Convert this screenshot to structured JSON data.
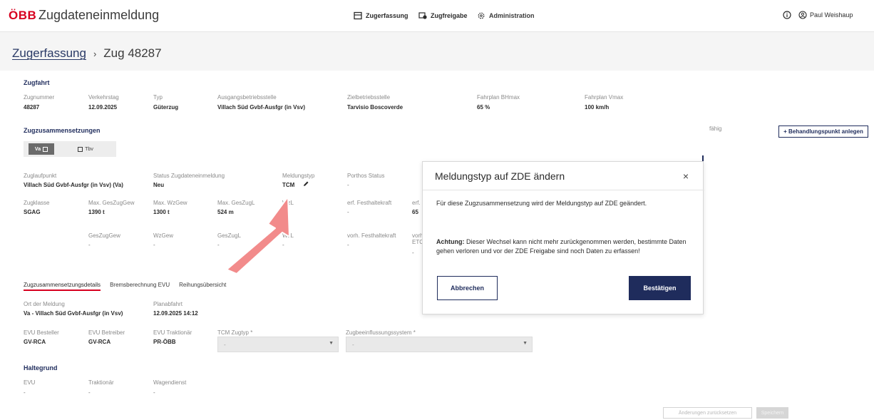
{
  "header": {
    "logo": "ÖBB",
    "app_title": "Zugdateneinmeldung",
    "nav": [
      {
        "label": "Zugerfassung",
        "icon": "train-window-icon"
      },
      {
        "label": "Zugfreigabe",
        "icon": "route-check-icon"
      },
      {
        "label": "Administration",
        "icon": "gear-icon"
      }
    ],
    "user": "Paul Weishaup"
  },
  "breadcrumb": {
    "link": "Zugerfassung",
    "separator": "›",
    "current": "Zug 48287"
  },
  "zugfahrt": {
    "heading": "Zugfahrt",
    "fields": [
      {
        "label": "Zugnummer",
        "value": "48287"
      },
      {
        "label": "Verkehrstag",
        "value": "12.09.2025"
      },
      {
        "label": "Typ",
        "value": "Güterzug"
      },
      {
        "label": "Ausgangsbetriebsstelle",
        "value": "Villach Süd Gvbf-Ausfgr (in Vsv)"
      },
      {
        "label": "Zielbetriebsstelle",
        "value": "Tarvisio Boscoverde"
      },
      {
        "label": "Fahrplan BHmax",
        "value": "65 %"
      },
      {
        "label": "Fahrplan Vmax",
        "value": "100 km/h"
      }
    ]
  },
  "zugzusammensetzungen": {
    "heading": "Zugzusammensetzungen",
    "add_button": "+ Behandlungspunkt anlegen",
    "pills": [
      {
        "label": "Va"
      },
      {
        "label": "Tbv"
      }
    ],
    "row1": [
      {
        "label": "Zuglaufpunkt",
        "value": "Villach Süd Gvbf-Ausfgr (in Vsv) (Va)"
      },
      {
        "label": "Status Zugdateneinmeldung",
        "value": "Neu"
      },
      {
        "label": "Meldungstyp",
        "value": "TCM"
      },
      {
        "label": "Porthos Status",
        "value": "-"
      }
    ],
    "row2": [
      {
        "label": "Zugklasse",
        "value": "SGAG"
      },
      {
        "label": "Max. GesZugGew",
        "value": "1390 t"
      },
      {
        "label": "Max. WzGew",
        "value": "1300 t"
      },
      {
        "label": "Max. GesZugL",
        "value": "524 m"
      },
      {
        "label": "WzL",
        "value": "m"
      },
      {
        "label": "erf. Festhaltekraft",
        "value": "-"
      },
      {
        "label": "erf.",
        "value": "65"
      }
    ],
    "row3": [
      {
        "label": "GesZugGew",
        "value": "-"
      },
      {
        "label": "WzGew",
        "value": "-"
      },
      {
        "label": "GesZugL",
        "value": "-"
      },
      {
        "label": "WzL",
        "value": "-"
      },
      {
        "label": "vorh. Festhaltekraft",
        "value": "-"
      },
      {
        "label": "vorh",
        "value": "ETC"
      },
      {
        "label": "",
        "value": "-"
      }
    ],
    "cutoff_label": "fähig"
  },
  "tabs": [
    "Zugzusammensetzungsdetails",
    "Bremsberechnung EVU",
    "Reihungsübersicht"
  ],
  "details": {
    "row1": [
      {
        "label": "Ort der Meldung",
        "value": "Va - Villach Süd Gvbf-Ausfgr (in Vsv)"
      },
      {
        "label": "Planabfahrt",
        "value": "12.09.2025 14:12"
      }
    ],
    "row2": [
      {
        "label": "EVU Besteller",
        "value": "GV-RCA"
      },
      {
        "label": "EVU Betreiber",
        "value": "GV-RCA"
      },
      {
        "label": "EVU Traktionär",
        "value": "PR-ÖBB"
      }
    ],
    "selects": [
      {
        "label": "TCM Zugtyp *",
        "placeholder": "-"
      },
      {
        "label": "Zugbeeinflussungssystem *",
        "placeholder": "-"
      }
    ]
  },
  "haltegrund": {
    "heading": "Haltegrund",
    "fields": [
      {
        "label": "EVU",
        "value": "-"
      },
      {
        "label": "Traktionär",
        "value": "-"
      },
      {
        "label": "Wagendienst",
        "value": "-"
      }
    ]
  },
  "footer": {
    "reset": "Änderungen zurücksetzen",
    "save": "Speichern"
  },
  "modal": {
    "title": "Meldungstyp auf ZDE ändern",
    "close": "×",
    "text1": "Für diese Zugzusammensetzung wird der Meldungstyp auf ZDE geändert.",
    "text2_bold": "Achtung:",
    "text2": "Dieser Wechsel kann nicht mehr zurückgenommen werden, bestimmte Daten gehen verloren und vor der ZDE Freigabe sind noch Daten zu erfassen!",
    "cancel": "Abbrechen",
    "confirm": "Bestätigen"
  },
  "colors": {
    "brand_red": "#d7001f",
    "navy": "#1f2c5c",
    "arrow": "#f28b8b"
  }
}
